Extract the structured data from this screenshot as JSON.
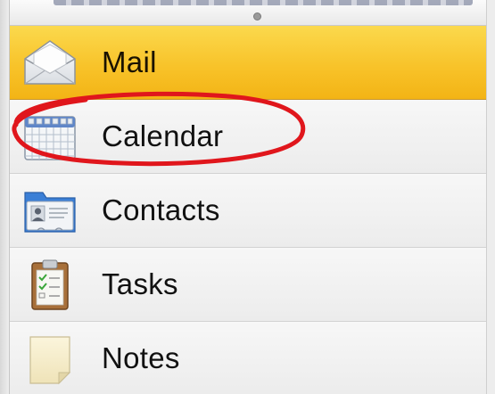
{
  "nav": {
    "items": [
      {
        "id": "mail",
        "label": "Mail",
        "icon": "envelope-icon",
        "selected": true
      },
      {
        "id": "calendar",
        "label": "Calendar",
        "icon": "calendar-icon",
        "selected": false
      },
      {
        "id": "contacts",
        "label": "Contacts",
        "icon": "contact-card-icon",
        "selected": false
      },
      {
        "id": "tasks",
        "label": "Tasks",
        "icon": "clipboard-checklist-icon",
        "selected": false
      },
      {
        "id": "notes",
        "label": "Notes",
        "icon": "sticky-note-icon",
        "selected": false
      }
    ]
  },
  "annotation": {
    "shape": "ellipse",
    "color": "#e0161c",
    "target": "calendar"
  },
  "colors": {
    "selected_bg": "#f8c32a",
    "row_bg": "#f1f1f1"
  }
}
